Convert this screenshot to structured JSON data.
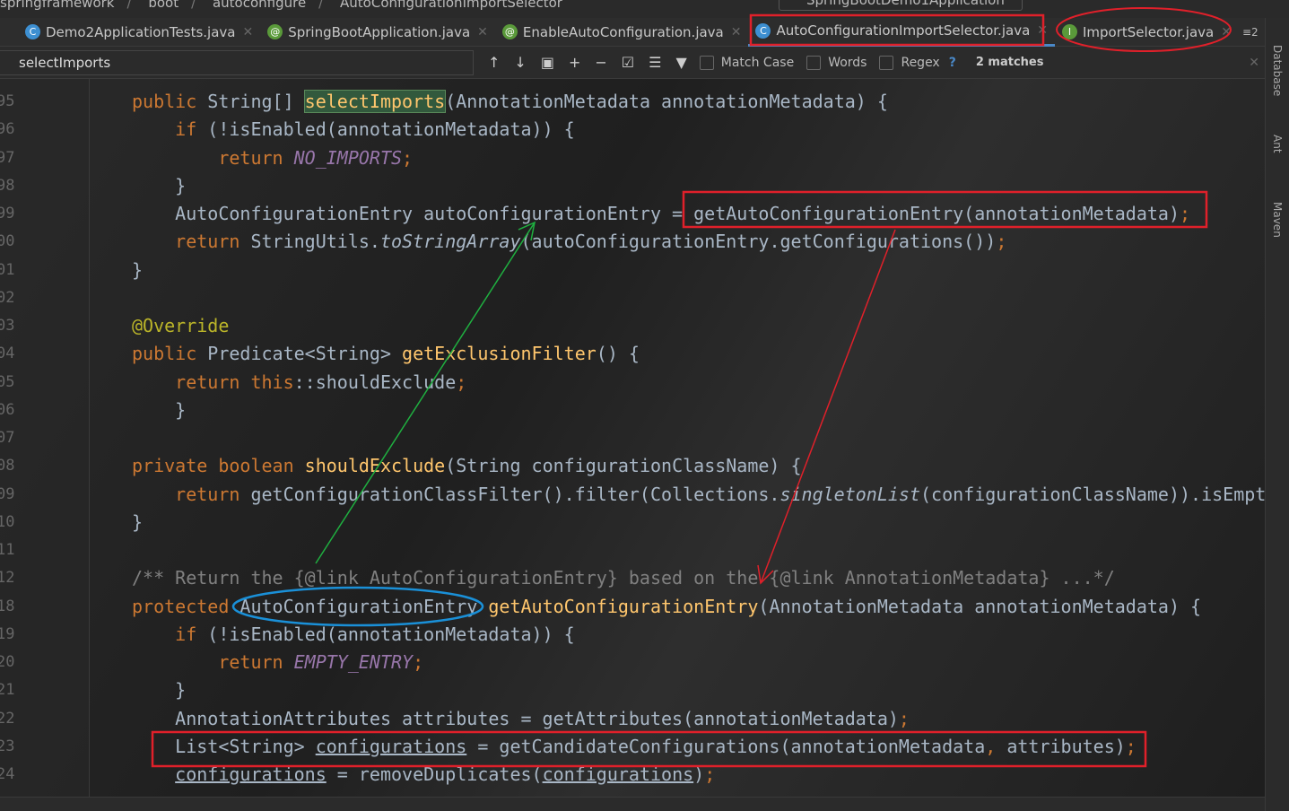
{
  "breadcrumb": [
    "springframework",
    "boot",
    "autoconfigure",
    "AutoConfigurationImportSelector"
  ],
  "run_config": "SpringBootDemo1Application",
  "tabs": [
    {
      "label": "Demo2ApplicationTests.java",
      "icon": "class-icon",
      "color": "#3d8fd1",
      "glyph": "C"
    },
    {
      "label": "SpringBootApplication.java",
      "icon": "annotation-icon",
      "color": "#5a9a3a",
      "glyph": "@"
    },
    {
      "label": "EnableAutoConfiguration.java",
      "icon": "annotation-icon",
      "color": "#5a9a3a",
      "glyph": "@"
    },
    {
      "label": "AutoConfigurationImportSelector.java",
      "icon": "class-icon",
      "color": "#3d8fd1",
      "glyph": "C",
      "active": true
    },
    {
      "label": "ImportSelector.java",
      "icon": "interface-icon",
      "color": "#5a9a3a",
      "glyph": "I"
    }
  ],
  "tab_overflow": "≡2",
  "search": {
    "value": "selectImports",
    "match_case": "Match Case",
    "words": "Words",
    "regex": "Regex",
    "help": "?",
    "matches": "2 matches"
  },
  "side_panels": [
    "Database",
    "Ant",
    "Maven"
  ],
  "code": [
    {
      "n": "95",
      "t": [
        [
          "public ",
          "k"
        ],
        [
          "String[] ",
          "t"
        ],
        [
          "selectImports",
          "h"
        ],
        [
          "(AnnotationMetadata annotationMetadata) {",
          "t"
        ]
      ]
    },
    {
      "n": "96",
      "t": [
        [
          "    if ",
          "k"
        ],
        [
          "(!isEnabled(annotationMetadata)) {",
          "t"
        ]
      ]
    },
    {
      "n": "97",
      "t": [
        [
          "        return ",
          "k"
        ],
        [
          "NO_IMPORTS",
          "s"
        ],
        [
          ";",
          "k"
        ]
      ]
    },
    {
      "n": "98",
      "t": [
        [
          "    }",
          "t"
        ]
      ]
    },
    {
      "n": "99",
      "t": [
        [
          "    AutoConfigurationEntry autoConfigurationEntry = getAutoConfigurationEntry(annotationMetadata)",
          "t"
        ],
        [
          ";",
          "k"
        ]
      ]
    },
    {
      "n": "00",
      "t": [
        [
          "    return ",
          "k"
        ],
        [
          "StringUtils.",
          "t"
        ],
        [
          "toStringArray",
          "i"
        ],
        [
          "(autoConfigurationEntry.getConfigurations())",
          "t"
        ],
        [
          ";",
          "k"
        ]
      ]
    },
    {
      "n": "01",
      "t": [
        [
          "}",
          "t"
        ]
      ]
    },
    {
      "n": "02",
      "t": []
    },
    {
      "n": "03",
      "t": [
        [
          "@Override",
          "a"
        ]
      ]
    },
    {
      "n": "04",
      "t": [
        [
          "public ",
          "k"
        ],
        [
          "Predicate<String> ",
          "t"
        ],
        [
          "getExclusionFilter",
          "m"
        ],
        [
          "() {",
          "t"
        ]
      ]
    },
    {
      "n": "05",
      "t": [
        [
          "    return this",
          "k"
        ],
        [
          "::shouldExclude",
          "t"
        ],
        [
          ";",
          "k"
        ]
      ]
    },
    {
      "n": "06",
      "t": [
        [
          "    }",
          "t"
        ]
      ]
    },
    {
      "n": "07",
      "t": []
    },
    {
      "n": "08",
      "t": [
        [
          "private boolean ",
          "k"
        ],
        [
          "shouldExclude",
          "m"
        ],
        [
          "(String configurationClassName) {",
          "t"
        ]
      ]
    },
    {
      "n": "09",
      "t": [
        [
          "    return ",
          "k"
        ],
        [
          "getConfigurationClassFilter().filter(Collections.",
          "t"
        ],
        [
          "singletonList",
          "i"
        ],
        [
          "(configurationClassName)).isEmpty",
          "t"
        ]
      ]
    },
    {
      "n": "10",
      "t": [
        [
          "}",
          "t"
        ]
      ]
    },
    {
      "n": "11",
      "t": []
    },
    {
      "n": "12",
      "t": [
        [
          "/** Return the {@link AutoConfigurationEntry} based on the {@link AnnotationMetadata} ...*/",
          "c"
        ]
      ]
    },
    {
      "n": "18",
      "t": [
        [
          "protected ",
          "k"
        ],
        [
          "AutoConfigurationEntry ",
          "t"
        ],
        [
          "getAutoConfigurationEntry",
          "m"
        ],
        [
          "(AnnotationMetadata annotationMetadata) {",
          "t"
        ]
      ]
    },
    {
      "n": "19",
      "t": [
        [
          "    if ",
          "k"
        ],
        [
          "(!isEnabled(annotationMetadata)) {",
          "t"
        ]
      ]
    },
    {
      "n": "20",
      "t": [
        [
          "        return ",
          "k"
        ],
        [
          "EMPTY_ENTRY",
          "s"
        ],
        [
          ";",
          "k"
        ]
      ]
    },
    {
      "n": "21",
      "t": [
        [
          "    }",
          "t"
        ]
      ]
    },
    {
      "n": "22",
      "t": [
        [
          "    AnnotationAttributes attributes = getAttributes(annotationMetadata)",
          "t"
        ],
        [
          ";",
          "k"
        ]
      ]
    },
    {
      "n": "23",
      "t": [
        [
          "    List<String> ",
          "t"
        ],
        [
          "configurations",
          "u"
        ],
        [
          " = getCandidateConfigurations(annotationMetadata",
          "t"
        ],
        [
          ", ",
          "k"
        ],
        [
          "attributes)",
          "t"
        ],
        [
          ";",
          "k"
        ]
      ]
    },
    {
      "n": "24",
      "t": [
        [
          "    ",
          "t"
        ],
        [
          "configurations",
          "u"
        ],
        [
          " = removeDuplicates(",
          "t"
        ],
        [
          "configurations",
          "u"
        ],
        [
          ")",
          "t"
        ],
        [
          ";",
          "k"
        ]
      ]
    }
  ]
}
